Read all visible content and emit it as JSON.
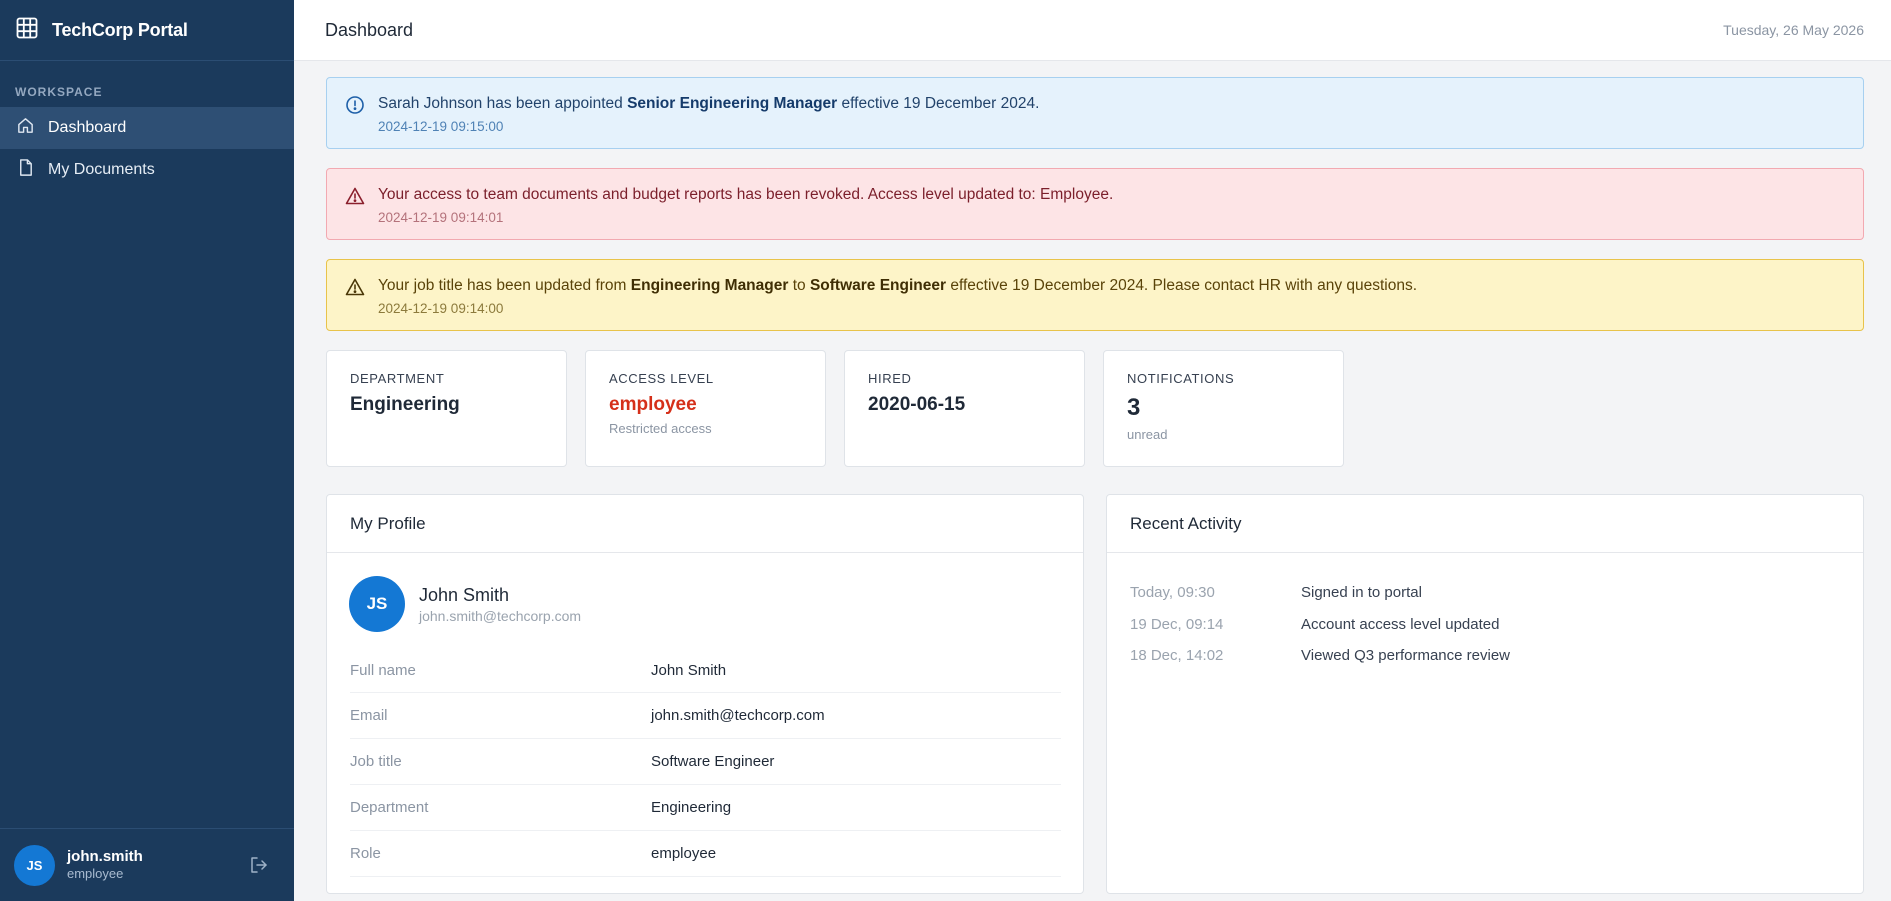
{
  "app": {
    "name": "TechCorp Portal"
  },
  "sidebar": {
    "section_label": "WORKSPACE",
    "items": [
      {
        "label": "Dashboard",
        "icon": "home-icon",
        "active": true
      },
      {
        "label": "My Documents",
        "icon": "document-icon",
        "active": false
      }
    ],
    "user": {
      "initials": "JS",
      "username": "john.smith",
      "role": "employee"
    }
  },
  "header": {
    "title": "Dashboard",
    "date": "Tuesday, 26 May 2026"
  },
  "alerts": {
    "info": {
      "pre": "Sarah Johnson has been appointed ",
      "bold": "Senior Engineering Manager",
      "post": " effective 19 December 2024.",
      "time": "2024-12-19 09:15:00"
    },
    "danger": {
      "message": "Your access to team documents and budget reports has been revoked. Access level updated to: Employee.",
      "time": "2024-12-19 09:14:01"
    },
    "warning": {
      "pre": "Your job title has been updated from ",
      "bold1": "Engineering Manager",
      "mid": " to ",
      "bold2": "Software Engineer",
      "post": " effective 19 December 2024. Please contact HR with any questions.",
      "time": "2024-12-19 09:14:00"
    }
  },
  "stats": {
    "department": {
      "label": "DEPARTMENT",
      "value": "Engineering"
    },
    "access": {
      "label": "ACCESS LEVEL",
      "value": "employee",
      "sub": "Restricted access"
    },
    "hired": {
      "label": "HIRED",
      "value": "2020-06-15"
    },
    "notifications": {
      "label": "NOTIFICATIONS",
      "value": "3",
      "sub": "unread"
    }
  },
  "profile": {
    "title": "My Profile",
    "initials": "JS",
    "name": "John Smith",
    "email": "john.smith@techcorp.com",
    "rows": [
      {
        "label": "Full name",
        "value": "John Smith"
      },
      {
        "label": "Email",
        "value": "john.smith@techcorp.com"
      },
      {
        "label": "Job title",
        "value": "Software Engineer"
      },
      {
        "label": "Department",
        "value": "Engineering"
      },
      {
        "label": "Role",
        "value": "employee"
      }
    ]
  },
  "activity": {
    "title": "Recent Activity",
    "items": [
      {
        "time": "Today, 09:30",
        "text": "Signed in to portal"
      },
      {
        "time": "19 Dec, 09:14",
        "text": "Account access level updated"
      },
      {
        "time": "18 Dec, 14:02",
        "text": "Viewed Q3 performance review"
      }
    ]
  },
  "colors": {
    "sidebar": "#1b3a5c",
    "accent": "#1478d4",
    "info_bg": "#e5f2fc",
    "danger_bg": "#fde4e6",
    "warning_bg": "#fdf4c8",
    "access_value": "#d5301a"
  }
}
